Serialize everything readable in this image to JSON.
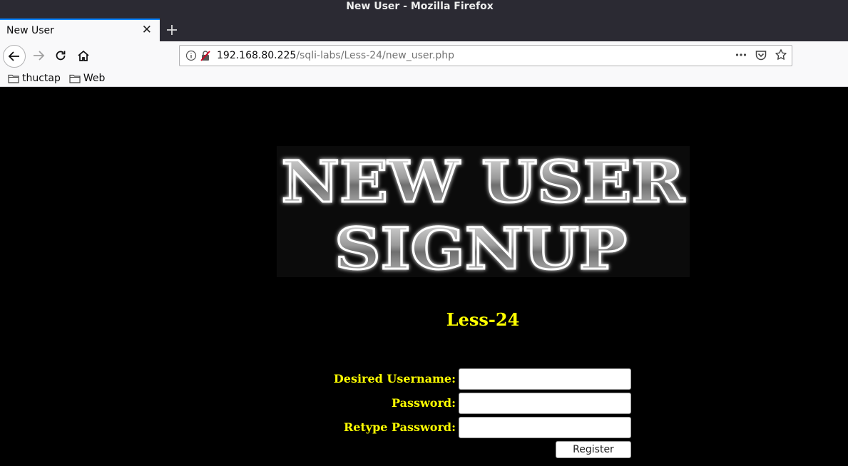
{
  "window": {
    "title": "New User - Mozilla Firefox"
  },
  "tabs": [
    {
      "label": "New User",
      "active": true
    }
  ],
  "navbar": {
    "url_host": "192.168.80.225",
    "url_path": "/sqli-labs/Less-24/new_user.php"
  },
  "bookmarks": [
    {
      "label": "thuctap",
      "icon": "folder-icon"
    },
    {
      "label": "Web",
      "icon": "folder-icon"
    }
  ],
  "page": {
    "banner_line1": "NEW USER",
    "banner_line2": "SIGNUP",
    "lesson": "Less-24",
    "form": {
      "username_label": "Desired Username:",
      "username_value": "",
      "password_label": "Password:",
      "password_value": "",
      "retype_label": "Retype Password:",
      "retype_value": "",
      "submit_label": "Register"
    }
  },
  "colors": {
    "accent": "#0a84ff",
    "page_background": "#000000",
    "label_yellow": "#ffff00"
  }
}
